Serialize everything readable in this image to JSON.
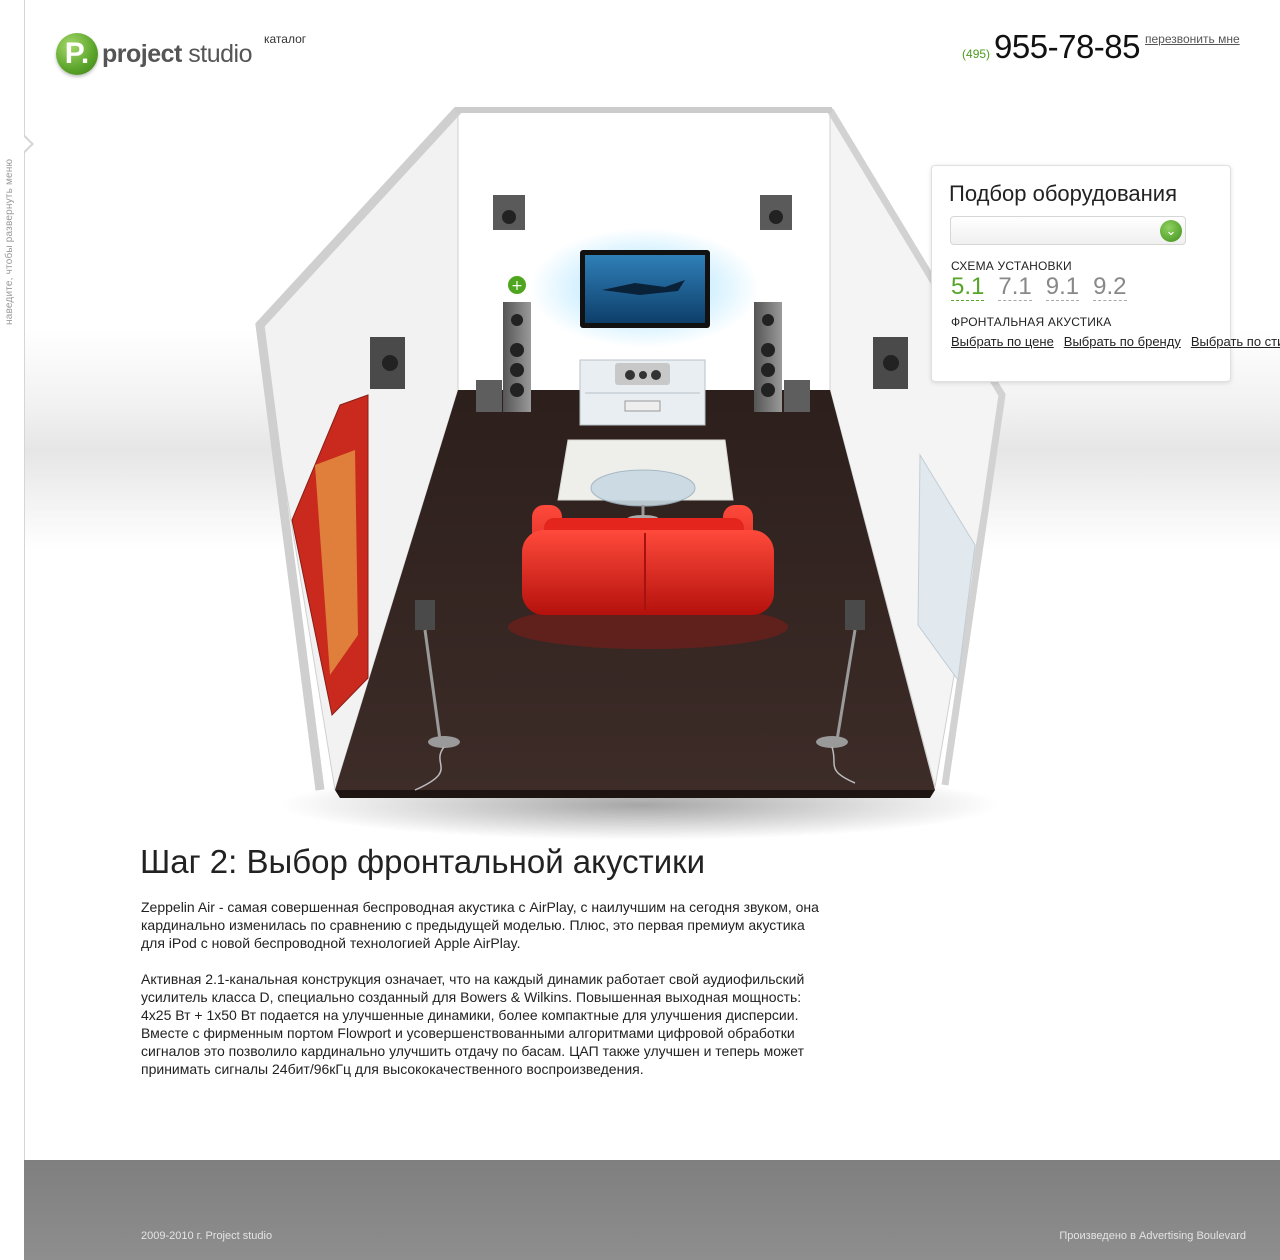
{
  "sidebar": {
    "hint": "наведите, чтобы развернуть меню"
  },
  "header": {
    "logo_letter": "P.",
    "logo_bold": "project",
    "logo_light": " studio",
    "catalog_label": "каталог",
    "phone_code": "(495)",
    "phone_number": "955-78-85",
    "callback_label": "перезвонить мне"
  },
  "scene": {
    "add_marker": "+"
  },
  "panel": {
    "title": "Подбор оборудования",
    "select_value": "",
    "select_icon": "chevron-down",
    "scheme_label": "СХЕМА УСТАНОВКИ",
    "schemes": [
      "5.1",
      "7.1",
      "9.1",
      "9.2"
    ],
    "active_scheme": "5.1",
    "front_label": "ФРОНТАЛЬНАЯ АКУСТИКА",
    "links": [
      "Выбрать по цене",
      "Выбрать по бренду",
      "Выбрать по стилю"
    ]
  },
  "content": {
    "heading": "Шаг 2: Выбор  фронтальной акустики",
    "paragraphs": [
      "Zeppelin Air - самая совершенная беспроводная акустика с AirPlay, с наилучшим на сегодня звуком, она кардинально изменилась по сравнению с предыдущей моделью. Плюс, это первая премиум акустика для iPod с новой беспроводной технологией Apple AirPlay.",
      "Активная 2.1-канальная конструкция означает, что на каждый динамик работает свой аудиофильский усилитель класса D, специально созданный для Bowers & Wilkins. Повышенная выходная мощность: 4x25 Вт + 1x50 Вт подается на улучшенные динамики, более компактные для улучшения дисперсии. Вместе с фирменным портом Flowport и усовершенствованными алгоритмами цифровой обработки сигналов это позволило кардинально улучшить отдачу по басам. ЦАП также улучшен и теперь может принимать сигналы 24бит/96кГц для высококачественного воспроизведения."
    ]
  },
  "footer": {
    "copyright": "2009-2010 г.  Project studio",
    "credit": "Произведено в Advertising Boulevard"
  },
  "colors": {
    "accent": "#56a52a",
    "sofa": "#d91f1a",
    "floor": "#3a2a26"
  }
}
